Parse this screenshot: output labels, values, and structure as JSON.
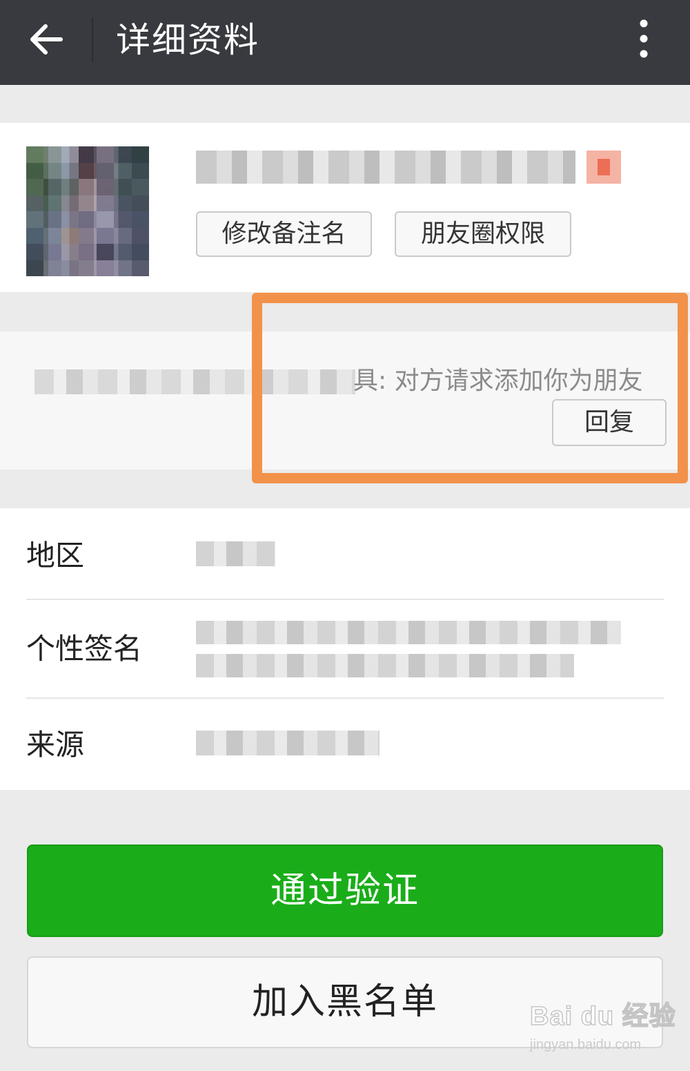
{
  "header": {
    "title": "详细资料",
    "back_icon": "arrow-left-icon",
    "more_icon": "more-vertical-icon"
  },
  "profile": {
    "remark_button": "修改备注名",
    "moments_button": "朋友圈权限",
    "gender_icon": "female-icon"
  },
  "verification": {
    "message_suffix": "具: 对方请求添加你为朋友",
    "reply_button": "回复"
  },
  "info": {
    "region_label": "地区",
    "signature_label": "个性签名",
    "source_label": "来源"
  },
  "actions": {
    "verify_button": "通过验证",
    "blacklist_button": "加入黑名单"
  },
  "watermark": {
    "logo": "Bai du 经验",
    "url": "jingyan.baidu.com"
  },
  "colors": {
    "header_bg": "#393a3f",
    "primary_green": "#1aad19",
    "highlight_orange": "#f2924a",
    "page_bg": "#ebebeb"
  }
}
